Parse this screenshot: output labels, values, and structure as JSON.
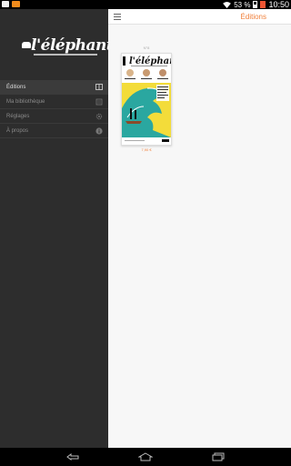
{
  "status_bar": {
    "battery_percent": "53 %",
    "time": "10:50"
  },
  "drawer": {
    "logo_text": "l'éléphant",
    "menu": [
      {
        "label": "Éditions",
        "icon": "book-icon",
        "active": true
      },
      {
        "label": "Ma bibliothèque",
        "icon": "library-icon",
        "active": false
      },
      {
        "label": "Réglages",
        "icon": "settings-icon",
        "active": false
      },
      {
        "label": "À propos",
        "icon": "info-icon",
        "active": false
      }
    ]
  },
  "header": {
    "title": "Éditions"
  },
  "issues": [
    {
      "number": "N°8",
      "cover_title": "l'éléphant",
      "price": "7,90 €"
    }
  ],
  "colors": {
    "accent": "#f0803c",
    "drawer_bg": "#2d2d2d",
    "content_bg": "#f7f7f7"
  }
}
